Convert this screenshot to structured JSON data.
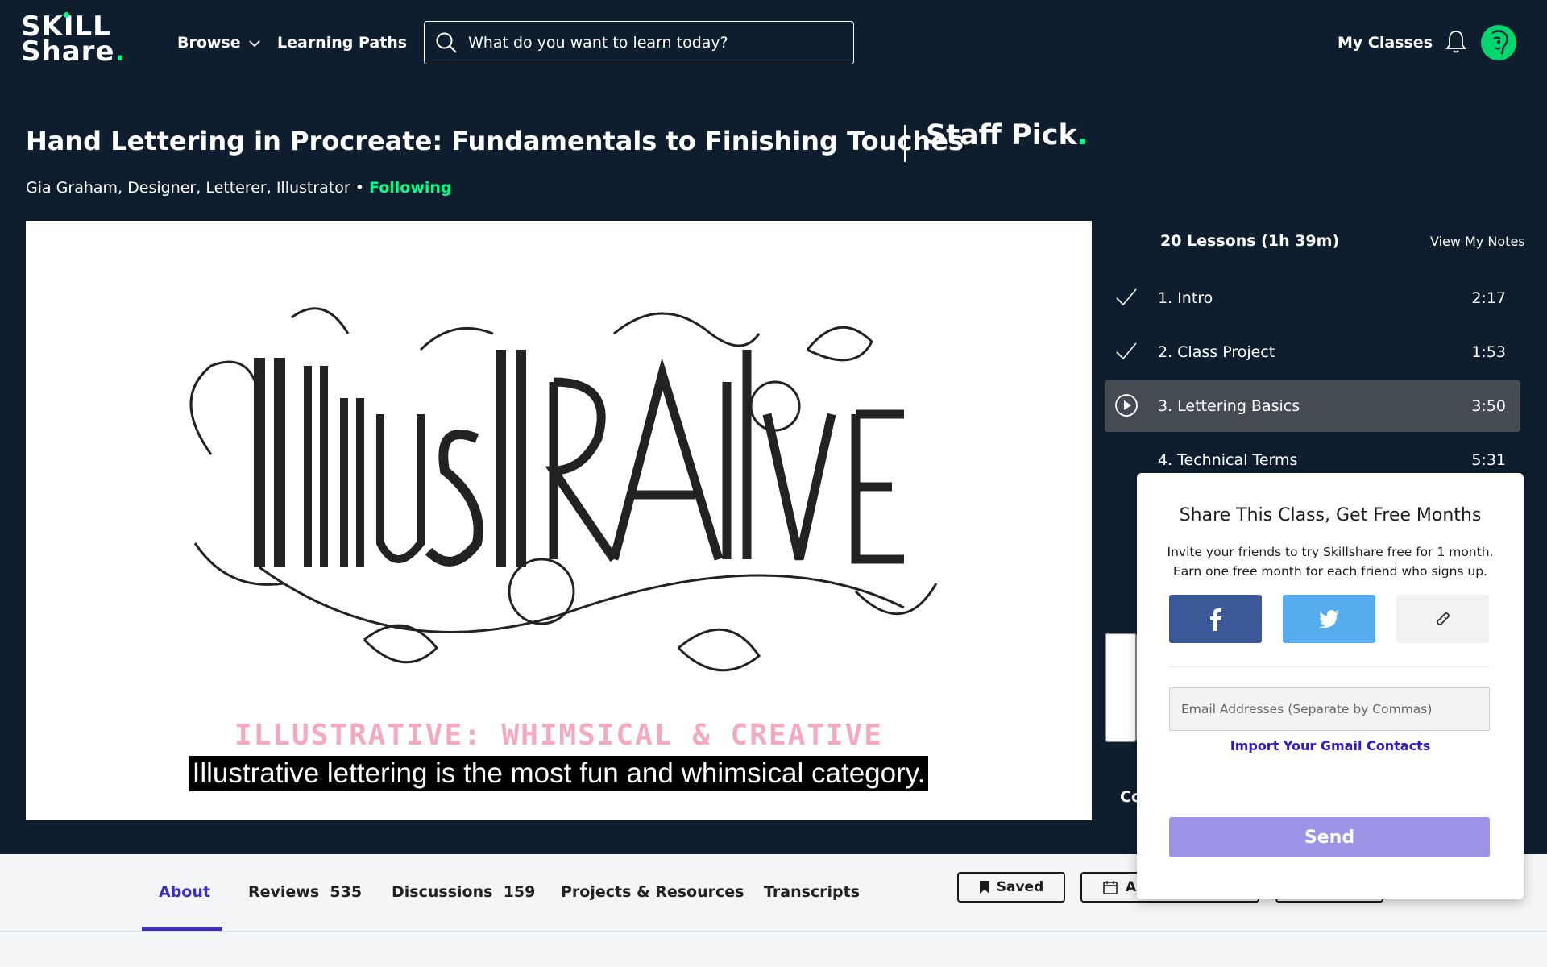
{
  "header": {
    "logo_line1": "SKILL",
    "logo_line2": "Share",
    "logo_dot": ".",
    "browse": "Browse",
    "learning_paths": "Learning Paths",
    "search_placeholder": "What do you want to learn today?",
    "my_classes": "My Classes"
  },
  "course": {
    "title": "Hand Lettering in Procreate: Fundamentals to Finishing Touches",
    "staff_pick": "Staff Pick",
    "staff_pick_dot": ".",
    "teacher": "Gia Graham, Designer, Letterer, Illustrator",
    "bullet": " • ",
    "following": "Following"
  },
  "video": {
    "subtitle_art": "ILLUSTRATIVE: WHIMSICAL & CREATIVE",
    "caption": "Illustrative lettering is the most fun and whimsical category."
  },
  "lessons": {
    "header": "20 Lessons (1h 39m)",
    "view_notes": "View My Notes",
    "items": [
      {
        "title": "1. Intro",
        "duration": "2:17",
        "state": "done"
      },
      {
        "title": "2. Class Project",
        "duration": "1:53",
        "state": "done"
      },
      {
        "title": "3. Lettering Basics",
        "duration": "3:50",
        "state": "playing"
      },
      {
        "title": "4. Technical Terms",
        "duration": "5:31",
        "state": "none"
      }
    ],
    "peek_text": "Co"
  },
  "tabs": {
    "about": "About",
    "reviews": "Reviews",
    "reviews_count": "535",
    "discussions": "Discussions",
    "discussions_count": "159",
    "projects": "Projects & Resources",
    "transcripts": "Transcripts",
    "saved": "Saved",
    "add_partial": "A"
  },
  "share": {
    "title": "Share This Class, Get Free Months",
    "desc_line1": "Invite your friends to try Skillshare free for 1 month.",
    "desc_line2": "Earn one free month for each friend who signs up.",
    "email_placeholder": "Email Addresses (Separate by Commas)",
    "import": "Import Your Gmail Contacts",
    "send": "Send"
  },
  "colors": {
    "background": "#0e1e2e",
    "accent_green": "#00ff84",
    "active_purple": "#3b2dc5",
    "facebook": "#3b5998",
    "twitter": "#55acee",
    "send": "#9d94e8"
  }
}
